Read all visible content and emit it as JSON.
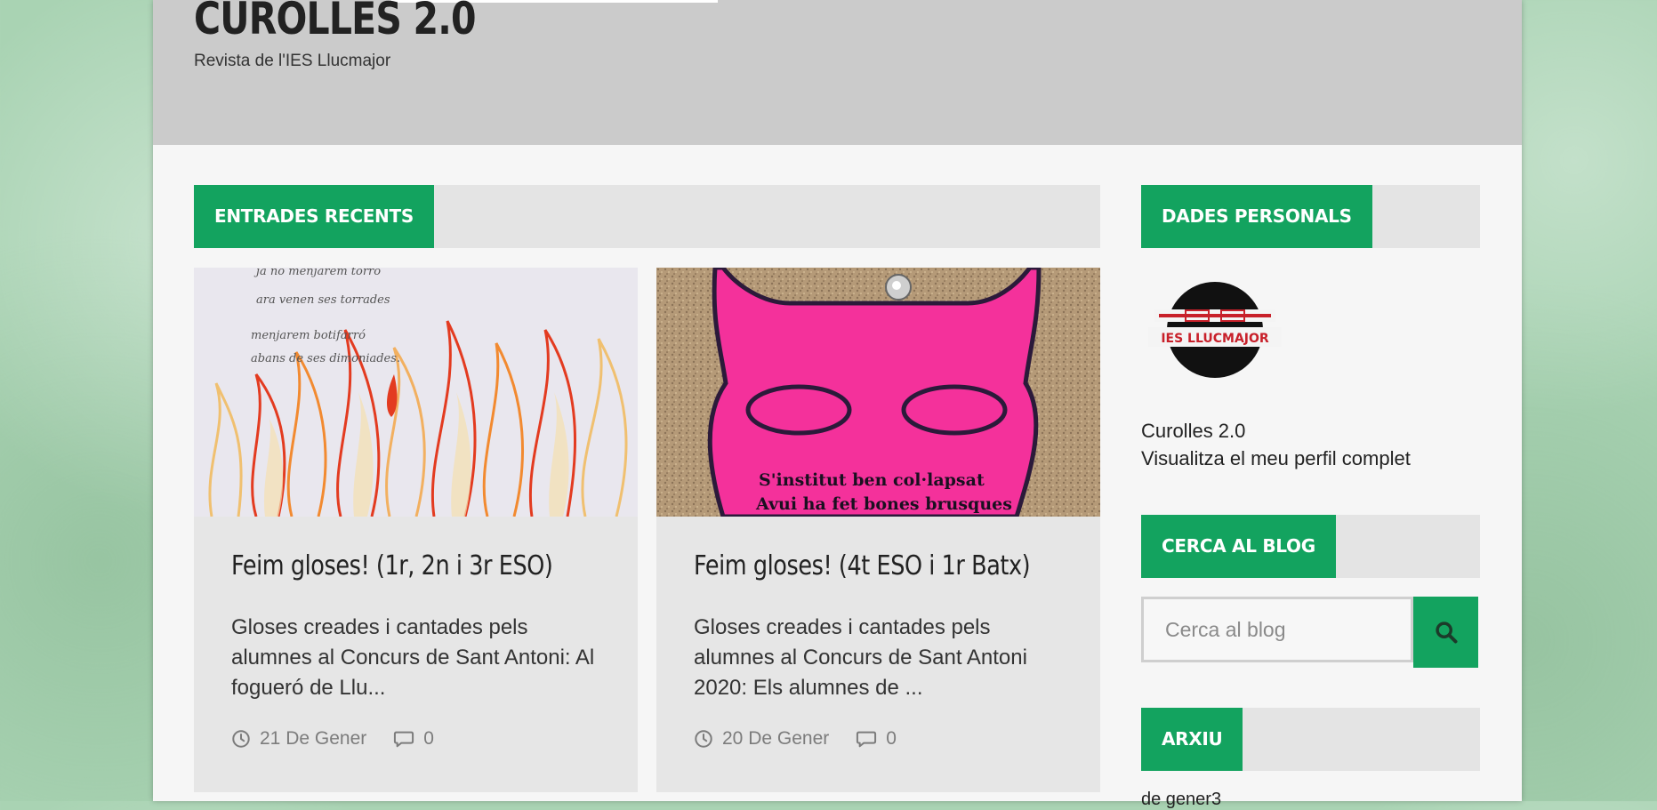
{
  "site": {
    "title": "CUROLLES 2.0",
    "description": "Revista de l'IES Llucmajor"
  },
  "sections": {
    "recent": "ENTRADES RECENTS",
    "profile": "DADES PERSONALS",
    "search": "CERCA AL BLOG",
    "archive": "ARXIU"
  },
  "posts": [
    {
      "title": "Feim gloses! (1r, 2n i 3r ESO)",
      "excerpt": "Gloses creades i cantades pels alumnes al Concurs de Sant Antoni: Al fogueró de Llu...",
      "date": "21 De Gener",
      "comments": "0",
      "image_text": [
        "ja no menjarem torro",
        "ara venen ses torrades",
        "menjarem botifarró",
        "abans de ses dimoniades."
      ]
    },
    {
      "title": "Feim gloses! (4t ESO i 1r Batx)",
      "excerpt": "Gloses creades i cantades pels alumnes al Concurs de Sant Antoni 2020: Els alumnes de ...",
      "date": "20 De Gener",
      "comments": "0",
      "image_text": [
        "S'institut ben col·lapsat",
        "Avui ha fet bones brusques"
      ]
    }
  ],
  "profile": {
    "logo_text": "IES LLUCMAJOR",
    "name": "Curolles 2.0",
    "link": "Visualitza el meu perfil complet"
  },
  "search": {
    "placeholder": "Cerca al blog",
    "icon": "search-icon"
  },
  "archive": {
    "first_item": "de gener3"
  },
  "colors": {
    "accent": "#13a35f",
    "header_bg": "#cbcbcb",
    "card_bg": "#e6e6e6",
    "page_bg": "#a9d3b3"
  }
}
